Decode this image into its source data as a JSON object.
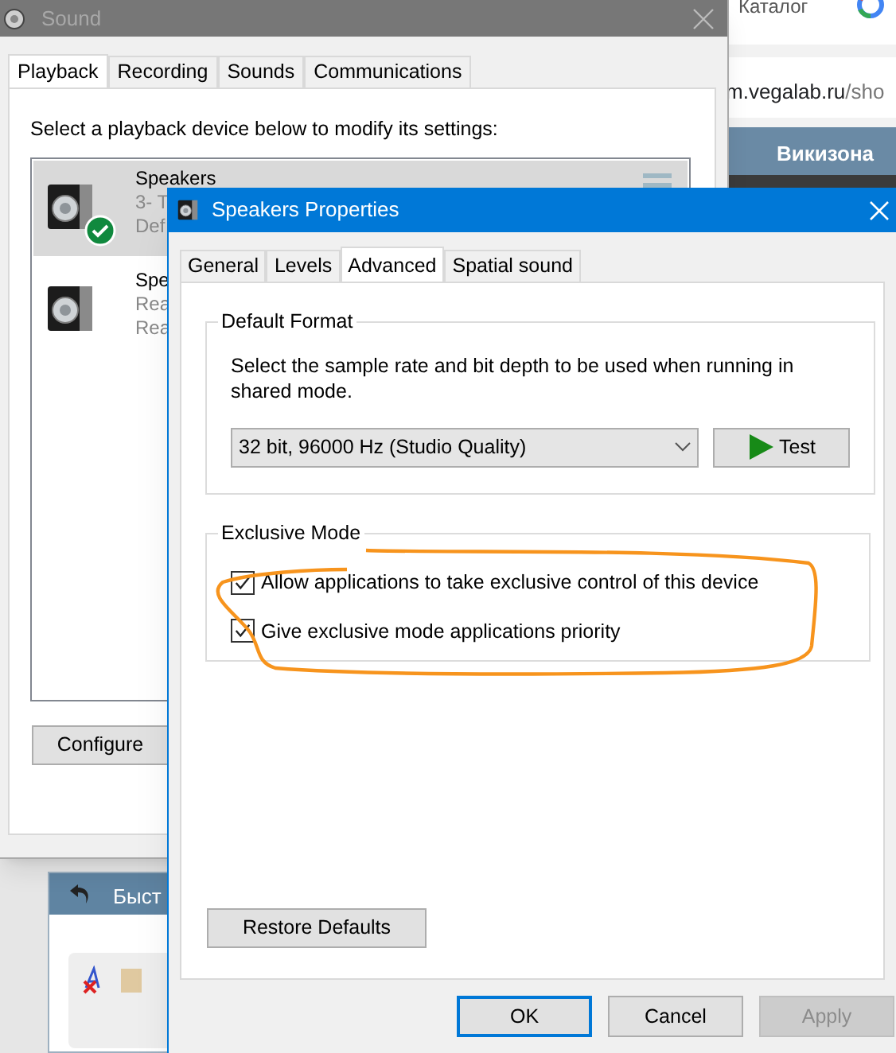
{
  "browser": {
    "tab_text": "Каталог",
    "address": "m.vegalab.ru",
    "address_path": "/sho",
    "nav_item": "Викизона",
    "panel_title": "Быст"
  },
  "sound_window": {
    "title": "Sound",
    "tabs": [
      {
        "label": "Playback",
        "selected": true
      },
      {
        "label": "Recording",
        "selected": false
      },
      {
        "label": "Sounds",
        "selected": false
      },
      {
        "label": "Communications",
        "selected": false
      }
    ],
    "instruction": "Select a playback device below to modify its settings:",
    "devices": [
      {
        "name": "Speakers",
        "line_2": "3- T",
        "line_3": "Def",
        "default": true,
        "selected": true
      },
      {
        "name": "Spe",
        "line_2": "Rea",
        "line_3": "Rea",
        "default": false,
        "selected": false
      }
    ],
    "configure_button": "Configure"
  },
  "properties_window": {
    "title": "Speakers Properties",
    "tabs": [
      {
        "label": "General",
        "selected": false
      },
      {
        "label": "Levels",
        "selected": false
      },
      {
        "label": "Advanced",
        "selected": true
      },
      {
        "label": "Spatial sound",
        "selected": false
      }
    ],
    "default_format": {
      "title": "Default Format",
      "description": "Select the sample rate and bit depth to be used when running in shared mode.",
      "format": "32 bit, 96000 Hz (Studio Quality)",
      "test_button": "Test"
    },
    "exclusive_mode": {
      "title": "Exclusive Mode",
      "options": [
        {
          "label": "Allow applications to take exclusive control of this device",
          "checked": true
        },
        {
          "label": "Give exclusive mode applications priority",
          "checked": true
        }
      ]
    },
    "restore_button": "Restore Defaults",
    "buttons": [
      {
        "label": "OK",
        "default": true,
        "disabled": false
      },
      {
        "label": "Cancel",
        "default": false,
        "disabled": false
      },
      {
        "label": "Apply",
        "default": false,
        "disabled": true
      }
    ]
  }
}
